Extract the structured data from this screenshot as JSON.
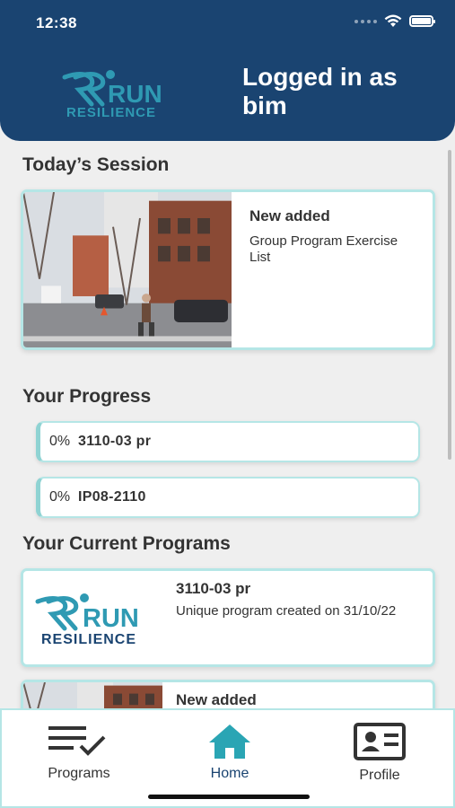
{
  "status_bar": {
    "time": "12:38"
  },
  "header": {
    "logo": {
      "word": "RUN",
      "tagline": "RESILIENCE"
    },
    "login_text": "Logged in as bim"
  },
  "today_session": {
    "title": "Today’s Session",
    "card": {
      "title": "New added",
      "subtitle": "Group Program Exercise List"
    }
  },
  "progress": {
    "title": "Your Progress",
    "items": [
      {
        "percent": "0%",
        "name": "3110-03 pr"
      },
      {
        "percent": "0%",
        "name": "IP08-2110"
      }
    ]
  },
  "current_programs": {
    "title": "Your Current Programs",
    "items": [
      {
        "title": "3110-03 pr",
        "subtitle": "Unique program created on 31/10/22"
      },
      {
        "title": "New added"
      }
    ]
  },
  "tabbar": {
    "programs": "Programs",
    "home": "Home",
    "profile": "Profile"
  },
  "colors": {
    "header_bg": "#1a4471",
    "accent": "#2f9ab3",
    "card_border": "#b5e6e6",
    "home_active": "#2aa5b4"
  },
  "icons": [
    "signal-dots-icon",
    "wifi-icon",
    "battery-icon",
    "checklist-icon",
    "home-icon",
    "profile-card-icon"
  ]
}
